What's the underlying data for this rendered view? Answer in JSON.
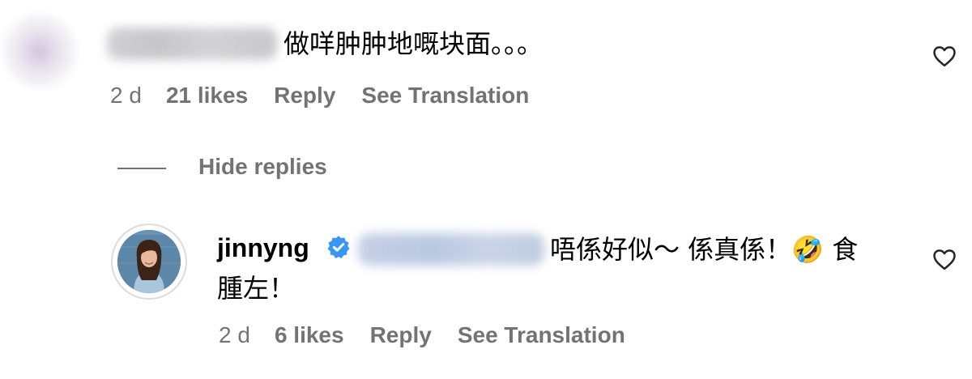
{
  "comments": [
    {
      "text": "做咩肿肿地嘅块面。。。",
      "time": "2 d",
      "likes": "21 likes",
      "reply_label": "Reply",
      "translate_label": "See Translation"
    }
  ],
  "hide_replies_label": "Hide replies",
  "reply": {
    "username": "jinnyng",
    "text_line1": "唔係好似～ 係真係！",
    "emoji": "🤣",
    "text_line1_end": " 食",
    "text_line2": "腫左！",
    "time": "2 d",
    "likes": "6 likes",
    "reply_label": "Reply",
    "translate_label": "See Translation"
  },
  "icons": {
    "like": "heart-outline-icon",
    "verified": "verified-badge-icon"
  },
  "colors": {
    "meta_text": "#737373",
    "verified_blue": "#3897f0"
  }
}
